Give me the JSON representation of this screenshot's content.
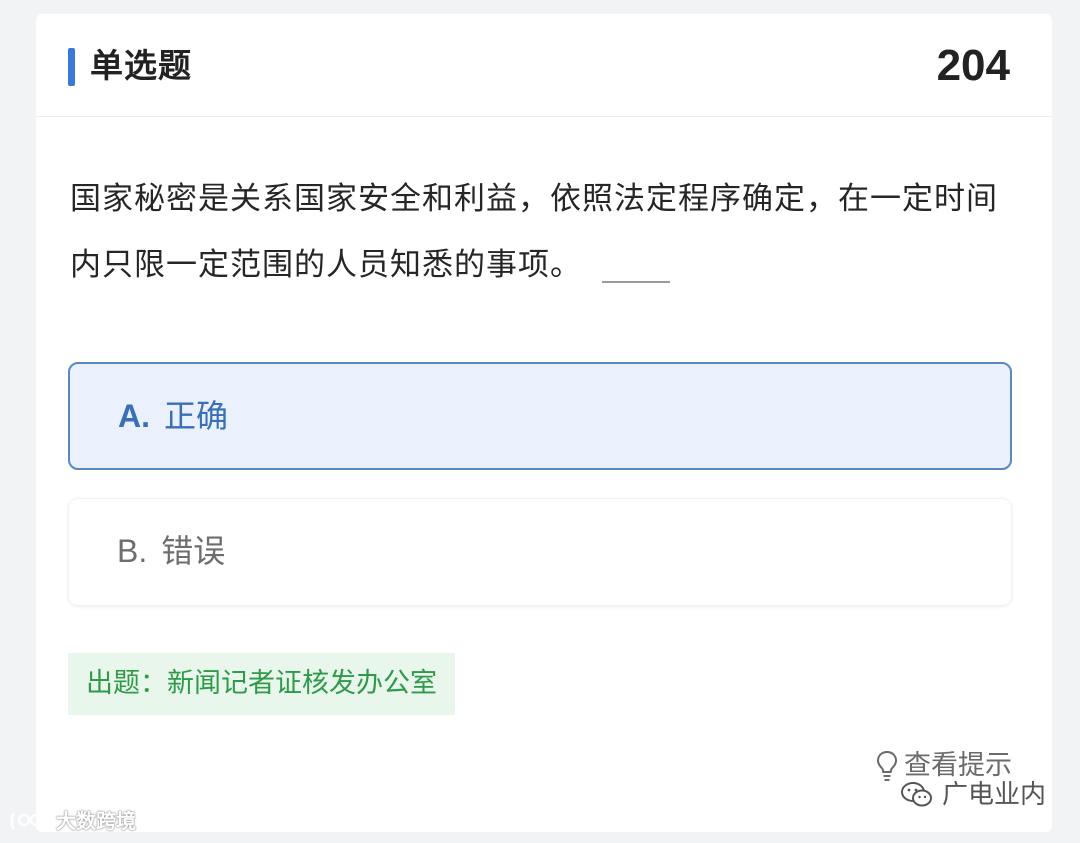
{
  "header": {
    "title": "单选题",
    "question_number": "204"
  },
  "question": {
    "text": "国家秘密是关系国家安全和利益，依照法定程序确定，在一定时间内只限一定范围的人员知悉的事项。"
  },
  "options": [
    {
      "letter": "A.",
      "label": "正确",
      "selected": true
    },
    {
      "letter": "B.",
      "label": "错误",
      "selected": false
    }
  ],
  "source": {
    "label": "出题：新闻记者证核发办公室"
  },
  "hint": {
    "label": "查看提示",
    "icon": "lightbulb-icon"
  },
  "watermarks": {
    "right": "广电业内",
    "left": "大数跨境"
  },
  "colors": {
    "accent": "#3a79d6",
    "selected_bg": "#eaf1fd",
    "selected_border": "#5b88bb",
    "source_green": "#2f9a4a",
    "source_bg": "#e9f6ec"
  }
}
